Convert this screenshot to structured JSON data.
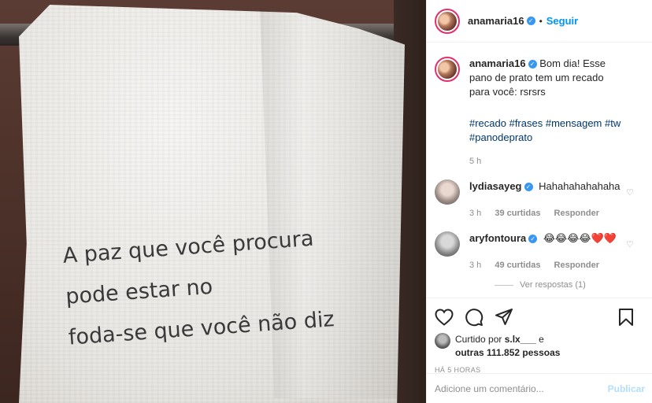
{
  "photo": {
    "towel_lines": [
      "A paz que você procura",
      "pode estar no",
      "foda-se que você não diz"
    ]
  },
  "header": {
    "username": "anamaria16",
    "separator": "•",
    "follow_label": "Seguir"
  },
  "caption": {
    "username": "anamaria16",
    "text": "Bom dia! Esse pano de prato tem um recado para você: rsrsrs",
    "hashtags": "#recado #frases #mensagem #tw #panodeprato",
    "time": "5 h"
  },
  "comments": [
    {
      "username": "lydiasayeg",
      "text": "Hahahahahahaha",
      "time": "3 h",
      "likes": "39 curtidas",
      "reply_label": "Responder"
    },
    {
      "username": "aryfontoura",
      "text": "😂😂😂😂❤️❤️",
      "time": "3 h",
      "likes": "49 curtidas",
      "reply_label": "Responder",
      "view_replies": "Ver respostas (1)"
    }
  ],
  "likes": {
    "prefix": "Curtido por ",
    "user": "s.lx___",
    "middle": " e",
    "others": "outras 111.852 pessoas"
  },
  "post_time": "HÁ 5 HORAS",
  "comment_box": {
    "placeholder": "Adicione um comentário...",
    "post_label": "Publicar"
  },
  "icons": [
    "heart-icon",
    "comment-icon",
    "share-icon",
    "bookmark-icon",
    "verified-badge-icon"
  ]
}
